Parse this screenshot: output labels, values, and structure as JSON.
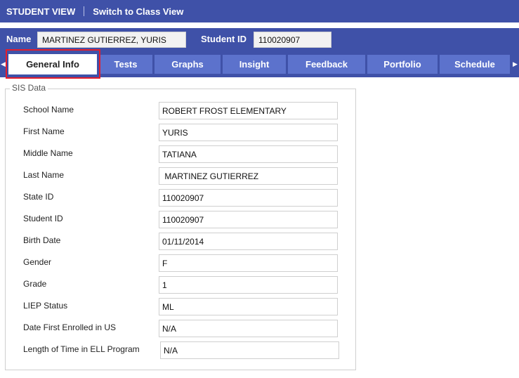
{
  "topbar": {
    "title": "STUDENT VIEW",
    "switch_link": "Switch to Class View"
  },
  "student": {
    "name_label": "Name",
    "name_value": "MARTINEZ GUTIERREZ, YURIS",
    "id_label": "Student ID",
    "id_value": "110020907"
  },
  "tabs": [
    {
      "label": "General Info",
      "active": true
    },
    {
      "label": "Tests"
    },
    {
      "label": "Graphs"
    },
    {
      "label": "Insight"
    },
    {
      "label": "Feedback"
    },
    {
      "label": "Portfolio"
    },
    {
      "label": "Schedule"
    }
  ],
  "sis": {
    "legend": "SIS Data",
    "rows": [
      {
        "label": "School Name",
        "value": "ROBERT FROST ELEMENTARY"
      },
      {
        "label": "First Name",
        "value": "YURIS"
      },
      {
        "label": "Middle Name",
        "value": "TATIANA"
      },
      {
        "label": "Last Name",
        "value": " MARTINEZ GUTIERREZ"
      },
      {
        "label": "State ID",
        "value": "110020907"
      },
      {
        "label": "Student ID",
        "value": "110020907"
      },
      {
        "label": "Birth Date",
        "value": "01/11/2014"
      },
      {
        "label": "Gender",
        "value": "F"
      },
      {
        "label": "Grade",
        "value": "1"
      },
      {
        "label": "LIEP Status",
        "value": "ML"
      },
      {
        "label": "Date First Enrolled in US",
        "value": "N/A"
      },
      {
        "label": "Length of Time in ELL Program",
        "value": "N/A"
      }
    ]
  },
  "colors": {
    "header": "#3f51a8",
    "tab": "#5c72cc",
    "highlight": "#e31e2d"
  }
}
